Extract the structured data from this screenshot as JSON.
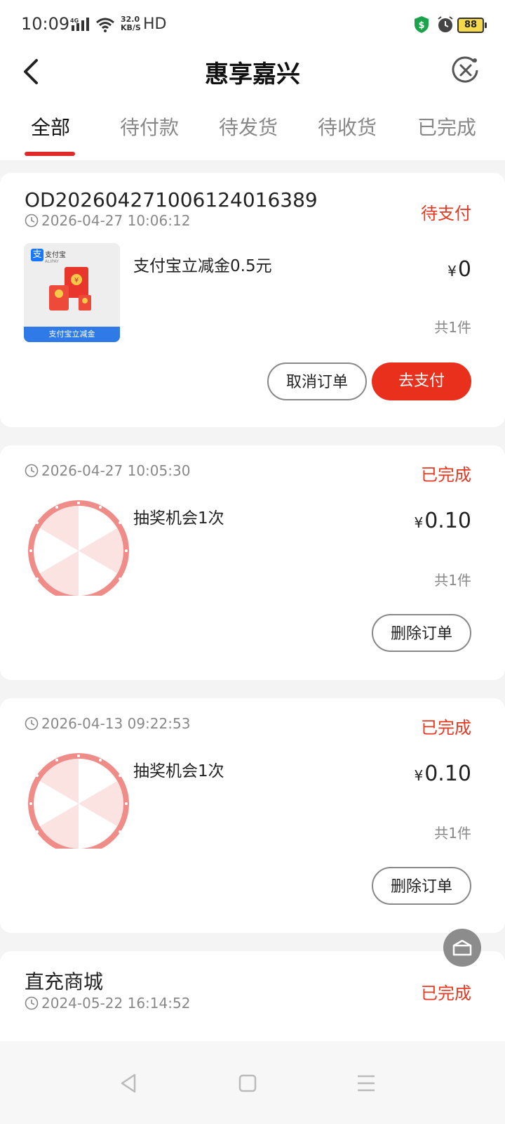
{
  "status_bar": {
    "time": "10:09",
    "network": "4G",
    "speed_value": "32.0",
    "speed_unit": "KB/S",
    "hd": "HD",
    "battery": "88"
  },
  "header": {
    "title": "惠享嘉兴",
    "back_icon": "chevron-left-icon",
    "close_icon": "close-circle-icon"
  },
  "tabs": [
    {
      "label": "全部",
      "active": true
    },
    {
      "label": "待付款",
      "active": false
    },
    {
      "label": "待发货",
      "active": false
    },
    {
      "label": "待收货",
      "active": false
    },
    {
      "label": "已完成",
      "active": false
    }
  ],
  "orders": [
    {
      "order_id": "OD202604271006124016389",
      "time": "2026-04-27 10:06:12",
      "status": "待支付",
      "product_name": "支付宝立减金0.5元",
      "currency": "¥",
      "price": "0",
      "quantity": "共1件",
      "thumb": {
        "brand": "支付宝",
        "brand_en": "ALIPAY",
        "banner": "支付宝立减金"
      },
      "buttons": [
        "取消订单",
        "去支付"
      ]
    },
    {
      "time": "2026-04-27 10:05:30",
      "status": "已完成",
      "product_name": "抽奖机会1次",
      "currency": "¥",
      "price": "0.10",
      "quantity": "共1件",
      "buttons": [
        "删除订单"
      ]
    },
    {
      "time": "2026-04-13 09:22:53",
      "status": "已完成",
      "product_name": "抽奖机会1次",
      "currency": "¥",
      "price": "0.10",
      "quantity": "共1件",
      "buttons": [
        "删除订单"
      ]
    },
    {
      "shop_name": "直充商城",
      "time": "2024-05-22 16:14:52",
      "status": "已完成"
    }
  ],
  "colors": {
    "accent": "#e8301c",
    "status_red": "#e53923",
    "tab_indicator": "#e02a2a"
  }
}
